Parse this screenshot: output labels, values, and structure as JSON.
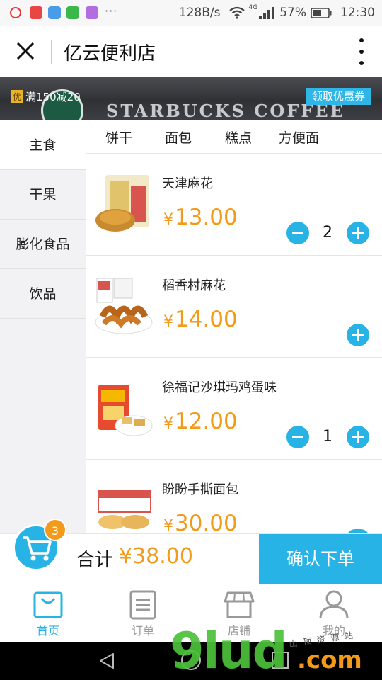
{
  "status_bar": {
    "speed": "128B/s",
    "network": "4G",
    "battery": "57%",
    "time": "12:30",
    "more": "···"
  },
  "header": {
    "title": "亿云便利店"
  },
  "banner": {
    "promo_badge": "优",
    "promo_text": "满150减20",
    "coupon_button": "领取优惠券",
    "image_text": "STARBUCKS COFFEE"
  },
  "sidebar": {
    "items": [
      {
        "label": "主食",
        "active": true
      },
      {
        "label": "干果",
        "active": false
      },
      {
        "label": "膨化食品",
        "active": false
      },
      {
        "label": "饮品",
        "active": false
      }
    ]
  },
  "subtabs": [
    "饼干",
    "面包",
    "糕点",
    "方便面"
  ],
  "products": [
    {
      "name": "天津麻花",
      "currency": "¥",
      "price": "13.00",
      "quantity": "2"
    },
    {
      "name": "稻香村麻花",
      "currency": "¥",
      "price": "14.00",
      "quantity": ""
    },
    {
      "name": "徐福记沙琪玛鸡蛋味",
      "currency": "¥",
      "price": "12.00",
      "quantity": "1"
    },
    {
      "name": "盼盼手撕面包",
      "currency": "¥",
      "price": "30.00",
      "quantity": ""
    }
  ],
  "cart": {
    "count": "3",
    "total_label": "合计",
    "total": "¥38.00",
    "confirm": "确认下单"
  },
  "tabbar": {
    "items": [
      {
        "label": "首页",
        "icon": "home-bag-icon"
      },
      {
        "label": "订单",
        "icon": "order-list-icon"
      },
      {
        "label": "店铺",
        "icon": "store-icon"
      },
      {
        "label": "我的",
        "icon": "user-icon"
      }
    ]
  },
  "watermark": {
    "main": "9lud",
    "com": ".com",
    "small": "山 顶 资 源 站"
  },
  "colors": {
    "accent": "#27b3e6",
    "price": "#f39a1a",
    "badge": "#f39a1a"
  }
}
